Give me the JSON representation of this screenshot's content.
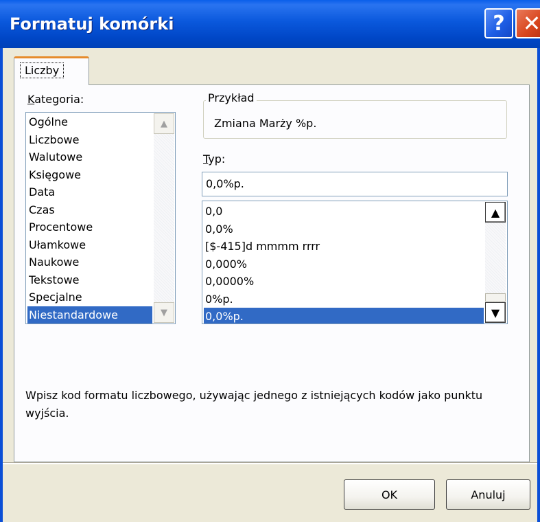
{
  "window": {
    "title": "Formatuj komórki",
    "help_label": "?",
    "close_label": "✕"
  },
  "tab": {
    "label": "Liczby"
  },
  "category": {
    "label_accel": "K",
    "label_rest": "ategoria:",
    "items": [
      "Ogólne",
      "Liczbowe",
      "Walutowe",
      "Księgowe",
      "Data",
      "Czas",
      "Procentowe",
      "Ułamkowe",
      "Naukowe",
      "Tekstowe",
      "Specjalne",
      "Niestandardowe"
    ],
    "selected": "Niestandardowe"
  },
  "example": {
    "label": "Przykład",
    "value": "Zmiana Marży %p."
  },
  "type": {
    "label_accel": "T",
    "label_rest": "yp:",
    "value": "0,0%p.",
    "items": [
      "0,0",
      "0,0%",
      "[$-415]d mmmm rrrr",
      "0,000%",
      "0,0000%",
      "0%p.",
      "0,0%p."
    ],
    "selected": "0,0%p."
  },
  "description": "Wpisz kod formatu liczbowego, używając jednego z istniejących kodów jako punktu wyjścia.",
  "buttons": {
    "ok": "OK",
    "cancel": "Anuluj"
  },
  "colors": {
    "titlebar": "#0a58dc",
    "selection": "#316ac5",
    "dialog_bg": "#ece9d8"
  }
}
